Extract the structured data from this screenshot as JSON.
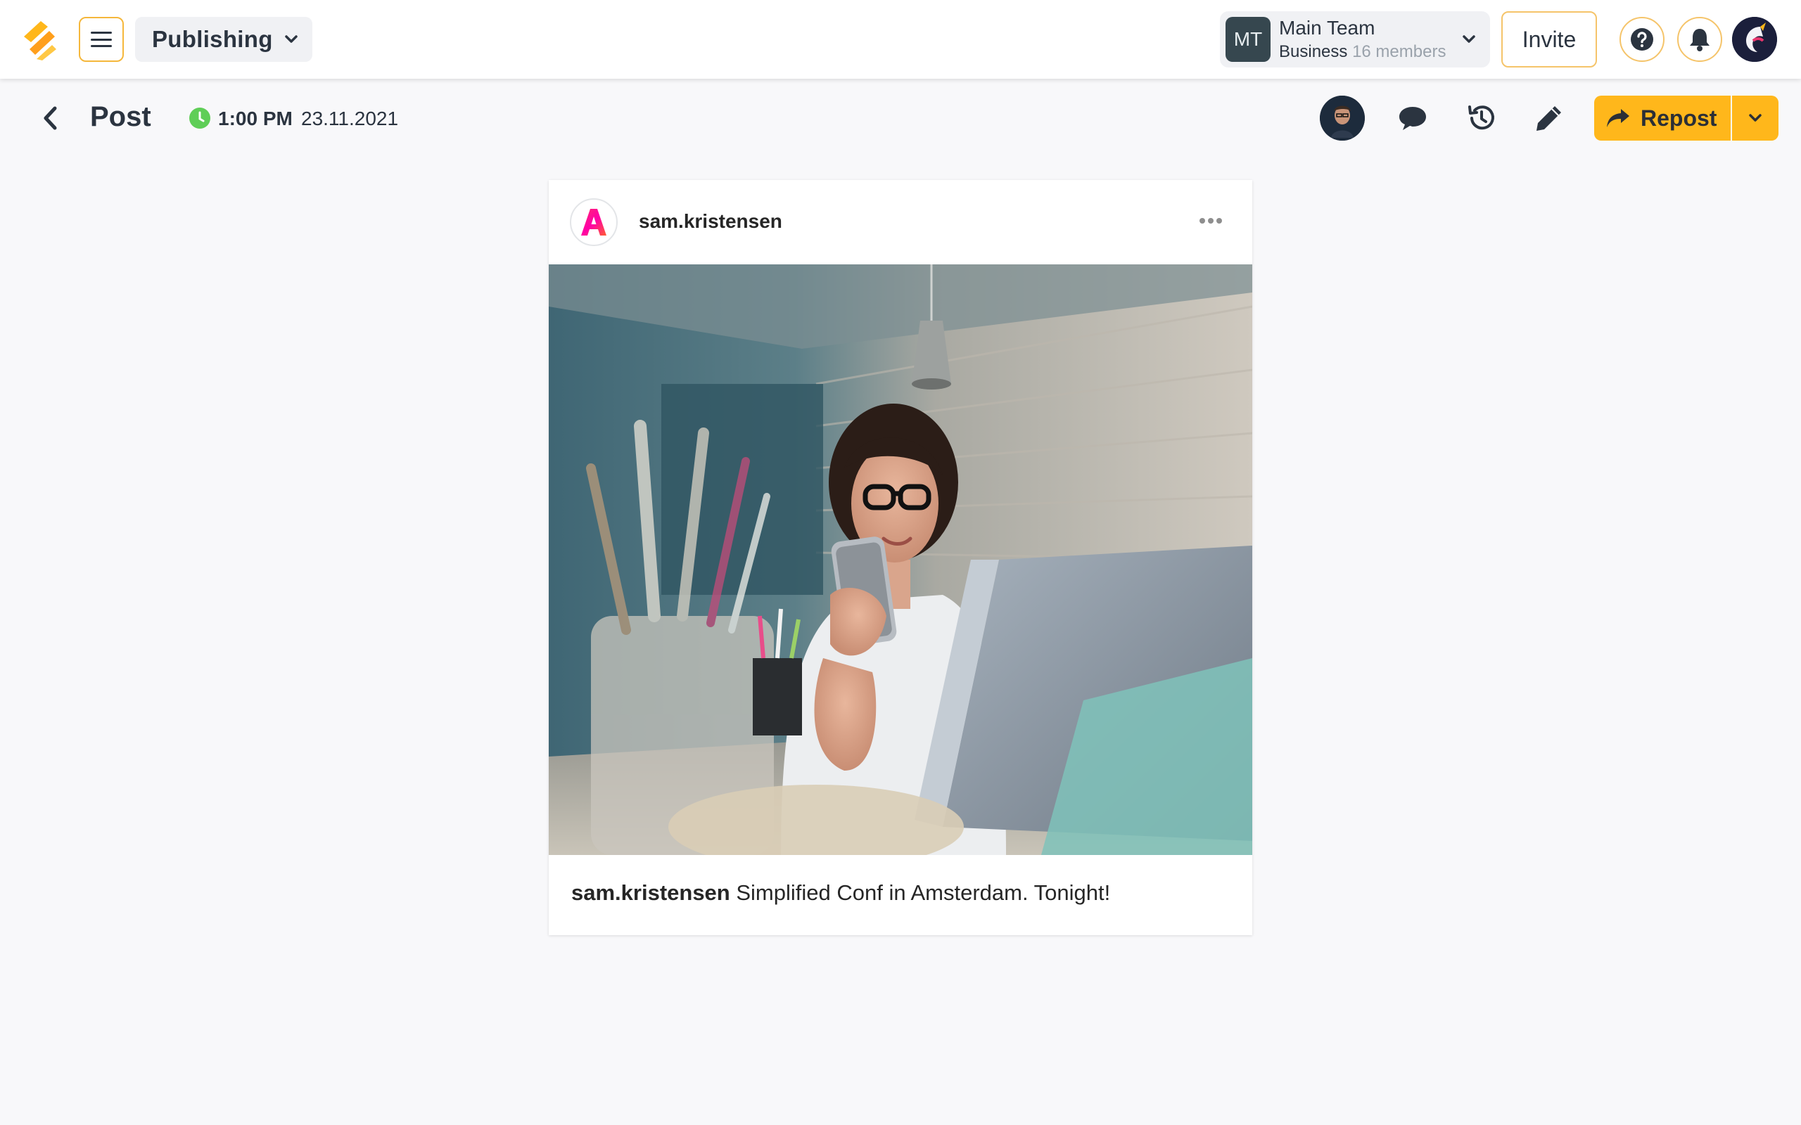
{
  "topbar": {
    "app_switcher_label": "Publishing",
    "team": {
      "initials": "MT",
      "name": "Main Team",
      "plan": "Business",
      "members": "16 members"
    },
    "invite_label": "Invite",
    "icons": [
      "menu-icon",
      "chevron-down-icon",
      "help-icon",
      "bell-icon"
    ],
    "accent_color": "#ffb71b"
  },
  "subheader": {
    "title": "Post",
    "time": "1:00 PM",
    "date": "23.11.2021",
    "status_color": "#5fce57",
    "repost_label": "Repost",
    "icons": [
      "back-icon",
      "clock-icon",
      "comment-icon",
      "history-icon",
      "edit-icon",
      "repost-icon"
    ]
  },
  "post": {
    "account": "sam.kristensen",
    "caption_user": "sam.kristensen",
    "caption_text": " Simplified Conf in Amsterdam. Tonight!",
    "photo_description": "woman with glasses holding a phone at a desk with a laptop"
  }
}
